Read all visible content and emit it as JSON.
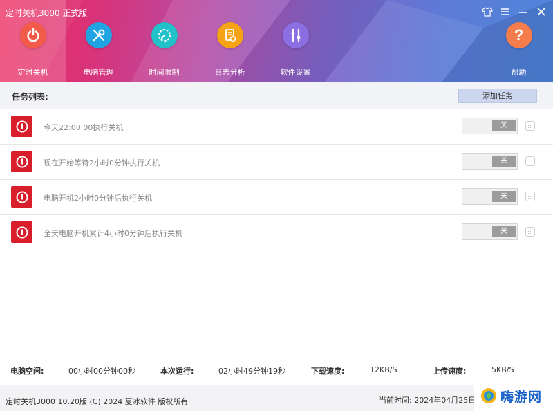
{
  "window": {
    "title": "定时关机3000 正式版",
    "controls": [
      "skin-icon",
      "menu-icon",
      "minimize-icon",
      "close-icon"
    ]
  },
  "nav": {
    "items": [
      {
        "label": "定时关机",
        "icon": "power-icon",
        "color": "#f25b4a",
        "active": true
      },
      {
        "label": "电脑管理",
        "icon": "tools-icon",
        "color": "#1fa3e3",
        "active": false
      },
      {
        "label": "时间限制",
        "icon": "timer-icon",
        "color": "#22c0c8",
        "active": false
      },
      {
        "label": "日志分析",
        "icon": "log-icon",
        "color": "#f5a315",
        "active": false
      },
      {
        "label": "软件设置",
        "icon": "settings-icon",
        "color": "#8a6ee2",
        "active": false
      }
    ],
    "help": {
      "label": "帮助",
      "icon": "help-icon",
      "color": "#f47c4d"
    }
  },
  "tasks": {
    "title": "任务列表:",
    "add_label": "添加任务",
    "items": [
      {
        "text": "今天22:00:00执行关机",
        "toggle": "关"
      },
      {
        "text": "现在开始等待2小时0分钟执行关机",
        "toggle": "关"
      },
      {
        "text": "电脑开机2小时0分钟后执行关机",
        "toggle": "关"
      },
      {
        "text": "全天电脑开机累计4小时0分钟后执行关机",
        "toggle": "关"
      }
    ]
  },
  "stats": {
    "idle_label": "电脑空闲:",
    "idle_value": "00小时00分钟00秒",
    "run_label": "本次运行:",
    "run_value": "02小时49分钟19秒",
    "down_label": "下载速度:",
    "down_value": "12KB/S",
    "up_label": "上传速度:",
    "up_value": "5KB/S"
  },
  "footer": {
    "copyright": "定时关机3000 10.20版 (C) 2024 夏冰软件 版权所有",
    "time_label": "当前时间:",
    "time_value": "2024年04月25日 1"
  },
  "watermark": {
    "text": "嗨游网"
  },
  "colors": {
    "accent": "#d81e2a",
    "header_start": "#ee2a5c",
    "header_end": "#4e86db",
    "add_button": "#ccd6ee"
  }
}
